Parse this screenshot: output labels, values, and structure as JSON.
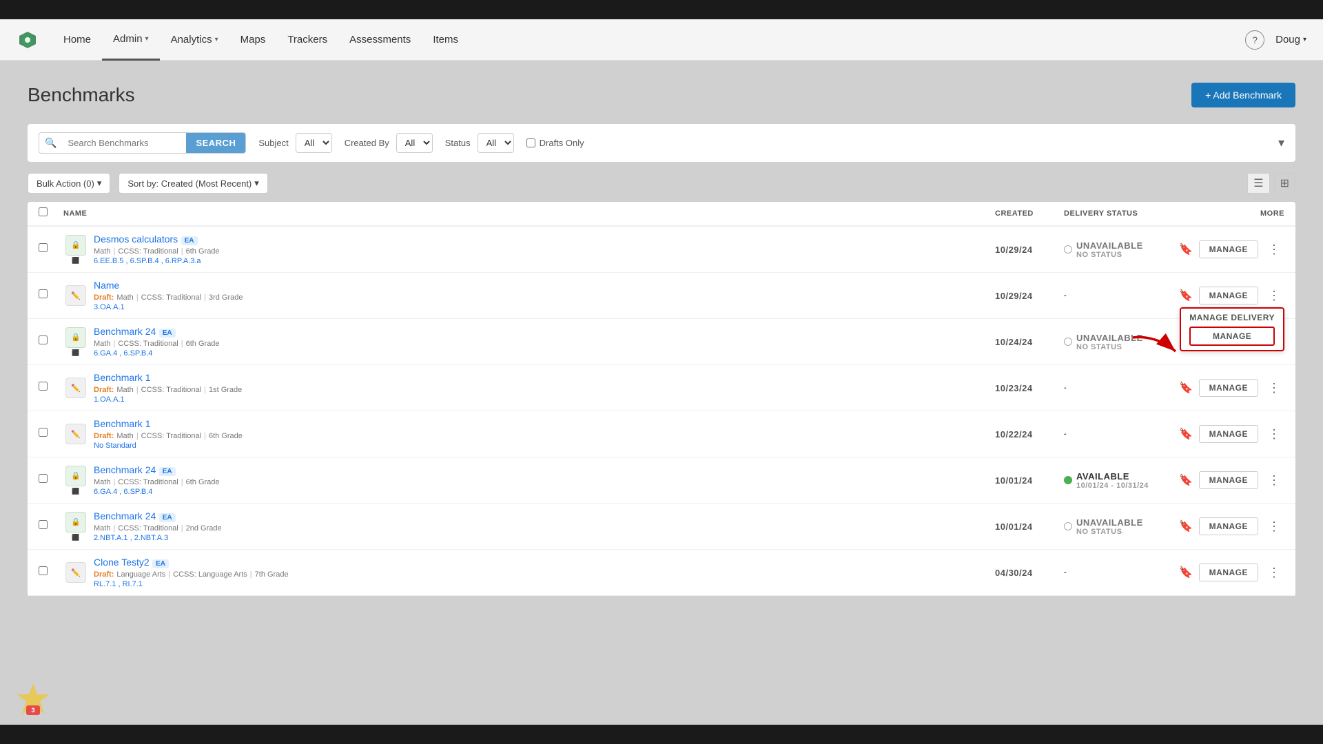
{
  "topBar": {},
  "navbar": {
    "logo": "logo",
    "items": [
      {
        "label": "Home",
        "active": false,
        "hasDropdown": false
      },
      {
        "label": "Admin",
        "active": true,
        "hasDropdown": true
      },
      {
        "label": "Analytics",
        "active": false,
        "hasDropdown": true
      },
      {
        "label": "Maps",
        "active": false,
        "hasDropdown": false
      },
      {
        "label": "Trackers",
        "active": false,
        "hasDropdown": false
      },
      {
        "label": "Assessments",
        "active": false,
        "hasDropdown": false
      },
      {
        "label": "Items",
        "active": false,
        "hasDropdown": false
      }
    ],
    "help_label": "?",
    "user_label": "Doug"
  },
  "page": {
    "title": "Benchmarks",
    "add_button": "+ Add Benchmark"
  },
  "filters": {
    "search_placeholder": "Search Benchmarks",
    "search_btn": "SEARCH",
    "subject_label": "Subject",
    "subject_value": "All",
    "created_by_label": "Created By",
    "created_by_value": "All",
    "status_label": "Status",
    "status_value": "All",
    "drafts_label": "Drafts Only"
  },
  "actionBar": {
    "bulk_action_label": "Bulk Action (0)",
    "sort_label": "Sort by: Created (Most Recent)"
  },
  "table": {
    "headers": {
      "name": "NAME",
      "created": "CREATED",
      "delivery": "DELIVERY STATUS",
      "more": "MORE"
    },
    "rows": [
      {
        "id": 1,
        "iconType": "lock",
        "name": "Desmos calculators",
        "badge": "EA",
        "meta": [
          "Math",
          "CCSS: Traditional",
          "6th Grade"
        ],
        "standards": "6.EE.B.5 , 6.SP.B.4 , 6.RP.A.3.a",
        "created": "10/29/24",
        "deliveryStatus": "Unavailable",
        "deliverySubtext": "No Status",
        "statusType": "unavailable",
        "isDraft": false,
        "hasPopup": false
      },
      {
        "id": 2,
        "iconType": "pencil",
        "name": "Name",
        "badge": "",
        "meta": [
          "Math",
          "CCSS: Traditional",
          "3rd Grade"
        ],
        "standards": "3.OA.A.1",
        "created": "10/29/24",
        "deliveryStatus": "-",
        "deliverySubtext": "",
        "statusType": "none",
        "isDraft": true,
        "hasPopup": false
      },
      {
        "id": 3,
        "iconType": "lock",
        "name": "Benchmark 24",
        "badge": "EA",
        "meta": [
          "Math",
          "CCSS: Traditional",
          "6th Grade"
        ],
        "standards": "6.GA.4 , 6.SP.B.4",
        "created": "10/24/24",
        "deliveryStatus": "Unavailable",
        "deliverySubtext": "No Status",
        "statusType": "unavailable",
        "isDraft": false,
        "hasPopup": true
      },
      {
        "id": 4,
        "iconType": "pencil",
        "name": "Benchmark 1",
        "badge": "",
        "meta": [
          "Math",
          "CCSS: Traditional",
          "1st Grade"
        ],
        "standards": "1.OA.A.1",
        "created": "10/23/24",
        "deliveryStatus": "-",
        "deliverySubtext": "",
        "statusType": "none",
        "isDraft": true,
        "hasPopup": false
      },
      {
        "id": 5,
        "iconType": "pencil",
        "name": "Benchmark 1",
        "badge": "",
        "meta": [
          "Math",
          "CCSS: Traditional",
          "6th Grade"
        ],
        "standards": "No Standard",
        "created": "10/22/24",
        "deliveryStatus": "-",
        "deliverySubtext": "",
        "statusType": "none",
        "isDraft": true,
        "hasPopup": false
      },
      {
        "id": 6,
        "iconType": "lock",
        "name": "Benchmark 24",
        "badge": "EA",
        "meta": [
          "Math",
          "CCSS: Traditional",
          "6th Grade"
        ],
        "standards": "6.GA.4 , 6.SP.B.4",
        "created": "10/01/24",
        "deliveryStatus": "Available",
        "deliverySubtext": "10/01/24 - 10/31/24",
        "statusType": "available",
        "isDraft": false,
        "hasPopup": false
      },
      {
        "id": 7,
        "iconType": "lock",
        "name": "Benchmark 24",
        "badge": "EA",
        "meta": [
          "Math",
          "CCSS: Traditional",
          "2nd Grade"
        ],
        "standards": "2.NBT.A.1 , 2.NBT.A.3",
        "created": "10/01/24",
        "deliveryStatus": "Unavailable",
        "deliverySubtext": "No Status",
        "statusType": "unavailable",
        "isDraft": false,
        "hasPopup": false
      },
      {
        "id": 8,
        "iconType": "pencil",
        "name": "Clone Testy2",
        "badge": "EA",
        "meta": [
          "Language Arts",
          "CCSS: Language Arts",
          "7th Grade"
        ],
        "standards": "RL.7.1 , RI.7.1",
        "created": "04/30/24",
        "deliveryStatus": "-",
        "deliverySubtext": "",
        "statusType": "none",
        "isDraft": true,
        "hasPopup": false
      }
    ]
  },
  "popup": {
    "tooltip_label": "Manage Delivery",
    "manage_btn_label": "MANAGE"
  }
}
